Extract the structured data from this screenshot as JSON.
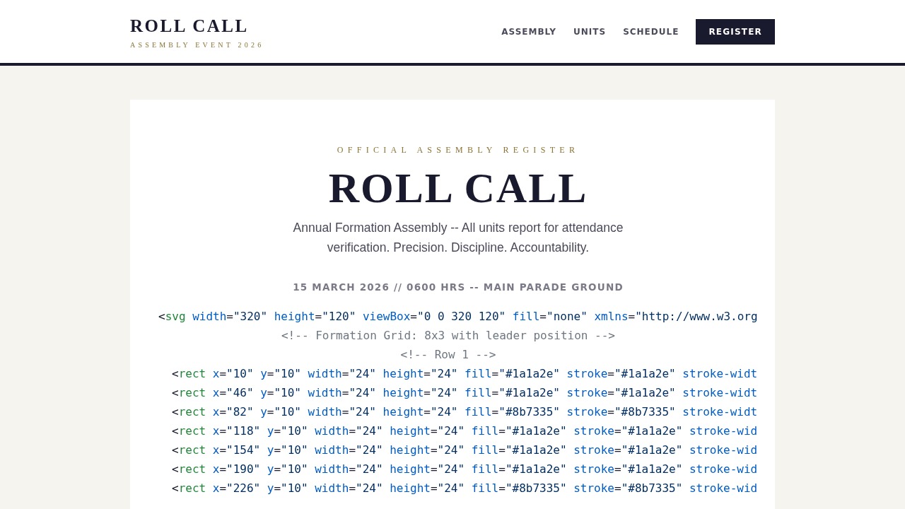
{
  "header": {
    "brand": "ROLL CALL",
    "tagline": "ASSEMBLY EVENT 2026",
    "nav": [
      {
        "label": "ASSEMBLY"
      },
      {
        "label": "UNITS"
      },
      {
        "label": "SCHEDULE"
      }
    ],
    "cta": "REGISTER"
  },
  "hero": {
    "eyebrow": "OFFICIAL ASSEMBLY REGISTER",
    "title": "ROLL CALL",
    "description": "Annual Formation Assembly -- All units report for attendance verification. Precision. Discipline. Accountability.",
    "meta": "15 MARCH 2026 // 0600 HRS -- MAIN PARADE GROUND"
  },
  "code": [
    {
      "kind": "root",
      "tokens": [
        {
          "kind": "punct",
          "text": "<"
        },
        {
          "kind": "tag",
          "text": "svg"
        },
        {
          "kind": "attr",
          "text": "width"
        },
        {
          "kind": "punct",
          "text": "="
        },
        {
          "kind": "string",
          "text": "\"320\""
        },
        {
          "kind": "attr",
          "text": "height"
        },
        {
          "kind": "punct",
          "text": "="
        },
        {
          "kind": "string",
          "text": "\"120\""
        },
        {
          "kind": "attr",
          "text": "viewBox"
        },
        {
          "kind": "punct",
          "text": "="
        },
        {
          "kind": "string",
          "text": "\"0 0 320 120\""
        },
        {
          "kind": "attr",
          "text": "fill"
        },
        {
          "kind": "punct",
          "text": "="
        },
        {
          "kind": "string",
          "text": "\"none\""
        },
        {
          "kind": "attr",
          "text": "xmlns"
        },
        {
          "kind": "punct",
          "text": "="
        },
        {
          "kind": "string",
          "text": "\"http://www.w3.org"
        }
      ]
    },
    {
      "kind": "comment",
      "tokens": [
        {
          "kind": "comment",
          "text": "<!-- Formation Grid: 8x3 with leader position -->"
        }
      ]
    },
    {
      "kind": "comment",
      "tokens": [
        {
          "kind": "comment",
          "text": "<!-- Row 1 -->"
        }
      ]
    },
    {
      "kind": "child",
      "tokens": [
        {
          "kind": "punct",
          "text": "<"
        },
        {
          "kind": "tag",
          "text": "rect"
        },
        {
          "kind": "attr",
          "text": "x"
        },
        {
          "kind": "punct",
          "text": "="
        },
        {
          "kind": "string",
          "text": "\"10\""
        },
        {
          "kind": "attr",
          "text": "y"
        },
        {
          "kind": "punct",
          "text": "="
        },
        {
          "kind": "string",
          "text": "\"10\""
        },
        {
          "kind": "attr",
          "text": "width"
        },
        {
          "kind": "punct",
          "text": "="
        },
        {
          "kind": "string",
          "text": "\"24\""
        },
        {
          "kind": "attr",
          "text": "height"
        },
        {
          "kind": "punct",
          "text": "="
        },
        {
          "kind": "string",
          "text": "\"24\""
        },
        {
          "kind": "attr",
          "text": "fill"
        },
        {
          "kind": "punct",
          "text": "="
        },
        {
          "kind": "string",
          "text": "\"#1a1a2e\""
        },
        {
          "kind": "attr",
          "text": "stroke"
        },
        {
          "kind": "punct",
          "text": "="
        },
        {
          "kind": "string",
          "text": "\"#1a1a2e\""
        },
        {
          "kind": "attr",
          "text": "stroke-widt"
        }
      ]
    },
    {
      "kind": "child",
      "tokens": [
        {
          "kind": "punct",
          "text": "<"
        },
        {
          "kind": "tag",
          "text": "rect"
        },
        {
          "kind": "attr",
          "text": "x"
        },
        {
          "kind": "punct",
          "text": "="
        },
        {
          "kind": "string",
          "text": "\"46\""
        },
        {
          "kind": "attr",
          "text": "y"
        },
        {
          "kind": "punct",
          "text": "="
        },
        {
          "kind": "string",
          "text": "\"10\""
        },
        {
          "kind": "attr",
          "text": "width"
        },
        {
          "kind": "punct",
          "text": "="
        },
        {
          "kind": "string",
          "text": "\"24\""
        },
        {
          "kind": "attr",
          "text": "height"
        },
        {
          "kind": "punct",
          "text": "="
        },
        {
          "kind": "string",
          "text": "\"24\""
        },
        {
          "kind": "attr",
          "text": "fill"
        },
        {
          "kind": "punct",
          "text": "="
        },
        {
          "kind": "string",
          "text": "\"#1a1a2e\""
        },
        {
          "kind": "attr",
          "text": "stroke"
        },
        {
          "kind": "punct",
          "text": "="
        },
        {
          "kind": "string",
          "text": "\"#1a1a2e\""
        },
        {
          "kind": "attr",
          "text": "stroke-widt"
        }
      ]
    },
    {
      "kind": "child",
      "tokens": [
        {
          "kind": "punct",
          "text": "<"
        },
        {
          "kind": "tag",
          "text": "rect"
        },
        {
          "kind": "attr",
          "text": "x"
        },
        {
          "kind": "punct",
          "text": "="
        },
        {
          "kind": "string",
          "text": "\"82\""
        },
        {
          "kind": "attr",
          "text": "y"
        },
        {
          "kind": "punct",
          "text": "="
        },
        {
          "kind": "string",
          "text": "\"10\""
        },
        {
          "kind": "attr",
          "text": "width"
        },
        {
          "kind": "punct",
          "text": "="
        },
        {
          "kind": "string",
          "text": "\"24\""
        },
        {
          "kind": "attr",
          "text": "height"
        },
        {
          "kind": "punct",
          "text": "="
        },
        {
          "kind": "string",
          "text": "\"24\""
        },
        {
          "kind": "attr",
          "text": "fill"
        },
        {
          "kind": "punct",
          "text": "="
        },
        {
          "kind": "string",
          "text": "\"#8b7335\""
        },
        {
          "kind": "attr",
          "text": "stroke"
        },
        {
          "kind": "punct",
          "text": "="
        },
        {
          "kind": "string",
          "text": "\"#8b7335\""
        },
        {
          "kind": "attr",
          "text": "stroke-widt"
        }
      ]
    },
    {
      "kind": "child",
      "tokens": [
        {
          "kind": "punct",
          "text": "<"
        },
        {
          "kind": "tag",
          "text": "rect"
        },
        {
          "kind": "attr",
          "text": "x"
        },
        {
          "kind": "punct",
          "text": "="
        },
        {
          "kind": "string",
          "text": "\"118\""
        },
        {
          "kind": "attr",
          "text": "y"
        },
        {
          "kind": "punct",
          "text": "="
        },
        {
          "kind": "string",
          "text": "\"10\""
        },
        {
          "kind": "attr",
          "text": "width"
        },
        {
          "kind": "punct",
          "text": "="
        },
        {
          "kind": "string",
          "text": "\"24\""
        },
        {
          "kind": "attr",
          "text": "height"
        },
        {
          "kind": "punct",
          "text": "="
        },
        {
          "kind": "string",
          "text": "\"24\""
        },
        {
          "kind": "attr",
          "text": "fill"
        },
        {
          "kind": "punct",
          "text": "="
        },
        {
          "kind": "string",
          "text": "\"#1a1a2e\""
        },
        {
          "kind": "attr",
          "text": "stroke"
        },
        {
          "kind": "punct",
          "text": "="
        },
        {
          "kind": "string",
          "text": "\"#1a1a2e\""
        },
        {
          "kind": "attr",
          "text": "stroke-wid"
        }
      ]
    },
    {
      "kind": "child",
      "tokens": [
        {
          "kind": "punct",
          "text": "<"
        },
        {
          "kind": "tag",
          "text": "rect"
        },
        {
          "kind": "attr",
          "text": "x"
        },
        {
          "kind": "punct",
          "text": "="
        },
        {
          "kind": "string",
          "text": "\"154\""
        },
        {
          "kind": "attr",
          "text": "y"
        },
        {
          "kind": "punct",
          "text": "="
        },
        {
          "kind": "string",
          "text": "\"10\""
        },
        {
          "kind": "attr",
          "text": "width"
        },
        {
          "kind": "punct",
          "text": "="
        },
        {
          "kind": "string",
          "text": "\"24\""
        },
        {
          "kind": "attr",
          "text": "height"
        },
        {
          "kind": "punct",
          "text": "="
        },
        {
          "kind": "string",
          "text": "\"24\""
        },
        {
          "kind": "attr",
          "text": "fill"
        },
        {
          "kind": "punct",
          "text": "="
        },
        {
          "kind": "string",
          "text": "\"#1a1a2e\""
        },
        {
          "kind": "attr",
          "text": "stroke"
        },
        {
          "kind": "punct",
          "text": "="
        },
        {
          "kind": "string",
          "text": "\"#1a1a2e\""
        },
        {
          "kind": "attr",
          "text": "stroke-wid"
        }
      ]
    },
    {
      "kind": "child",
      "tokens": [
        {
          "kind": "punct",
          "text": "<"
        },
        {
          "kind": "tag",
          "text": "rect"
        },
        {
          "kind": "attr",
          "text": "x"
        },
        {
          "kind": "punct",
          "text": "="
        },
        {
          "kind": "string",
          "text": "\"190\""
        },
        {
          "kind": "attr",
          "text": "y"
        },
        {
          "kind": "punct",
          "text": "="
        },
        {
          "kind": "string",
          "text": "\"10\""
        },
        {
          "kind": "attr",
          "text": "width"
        },
        {
          "kind": "punct",
          "text": "="
        },
        {
          "kind": "string",
          "text": "\"24\""
        },
        {
          "kind": "attr",
          "text": "height"
        },
        {
          "kind": "punct",
          "text": "="
        },
        {
          "kind": "string",
          "text": "\"24\""
        },
        {
          "kind": "attr",
          "text": "fill"
        },
        {
          "kind": "punct",
          "text": "="
        },
        {
          "kind": "string",
          "text": "\"#1a1a2e\""
        },
        {
          "kind": "attr",
          "text": "stroke"
        },
        {
          "kind": "punct",
          "text": "="
        },
        {
          "kind": "string",
          "text": "\"#1a1a2e\""
        },
        {
          "kind": "attr",
          "text": "stroke-wid"
        }
      ]
    },
    {
      "kind": "child",
      "tokens": [
        {
          "kind": "punct",
          "text": "<"
        },
        {
          "kind": "tag",
          "text": "rect"
        },
        {
          "kind": "attr",
          "text": "x"
        },
        {
          "kind": "punct",
          "text": "="
        },
        {
          "kind": "string",
          "text": "\"226\""
        },
        {
          "kind": "attr",
          "text": "y"
        },
        {
          "kind": "punct",
          "text": "="
        },
        {
          "kind": "string",
          "text": "\"10\""
        },
        {
          "kind": "attr",
          "text": "width"
        },
        {
          "kind": "punct",
          "text": "="
        },
        {
          "kind": "string",
          "text": "\"24\""
        },
        {
          "kind": "attr",
          "text": "height"
        },
        {
          "kind": "punct",
          "text": "="
        },
        {
          "kind": "string",
          "text": "\"24\""
        },
        {
          "kind": "attr",
          "text": "fill"
        },
        {
          "kind": "punct",
          "text": "="
        },
        {
          "kind": "string",
          "text": "\"#8b7335\""
        },
        {
          "kind": "attr",
          "text": "stroke"
        },
        {
          "kind": "punct",
          "text": "="
        },
        {
          "kind": "string",
          "text": "\"#8b7335\""
        },
        {
          "kind": "attr",
          "text": "stroke-wid"
        }
      ]
    }
  ]
}
